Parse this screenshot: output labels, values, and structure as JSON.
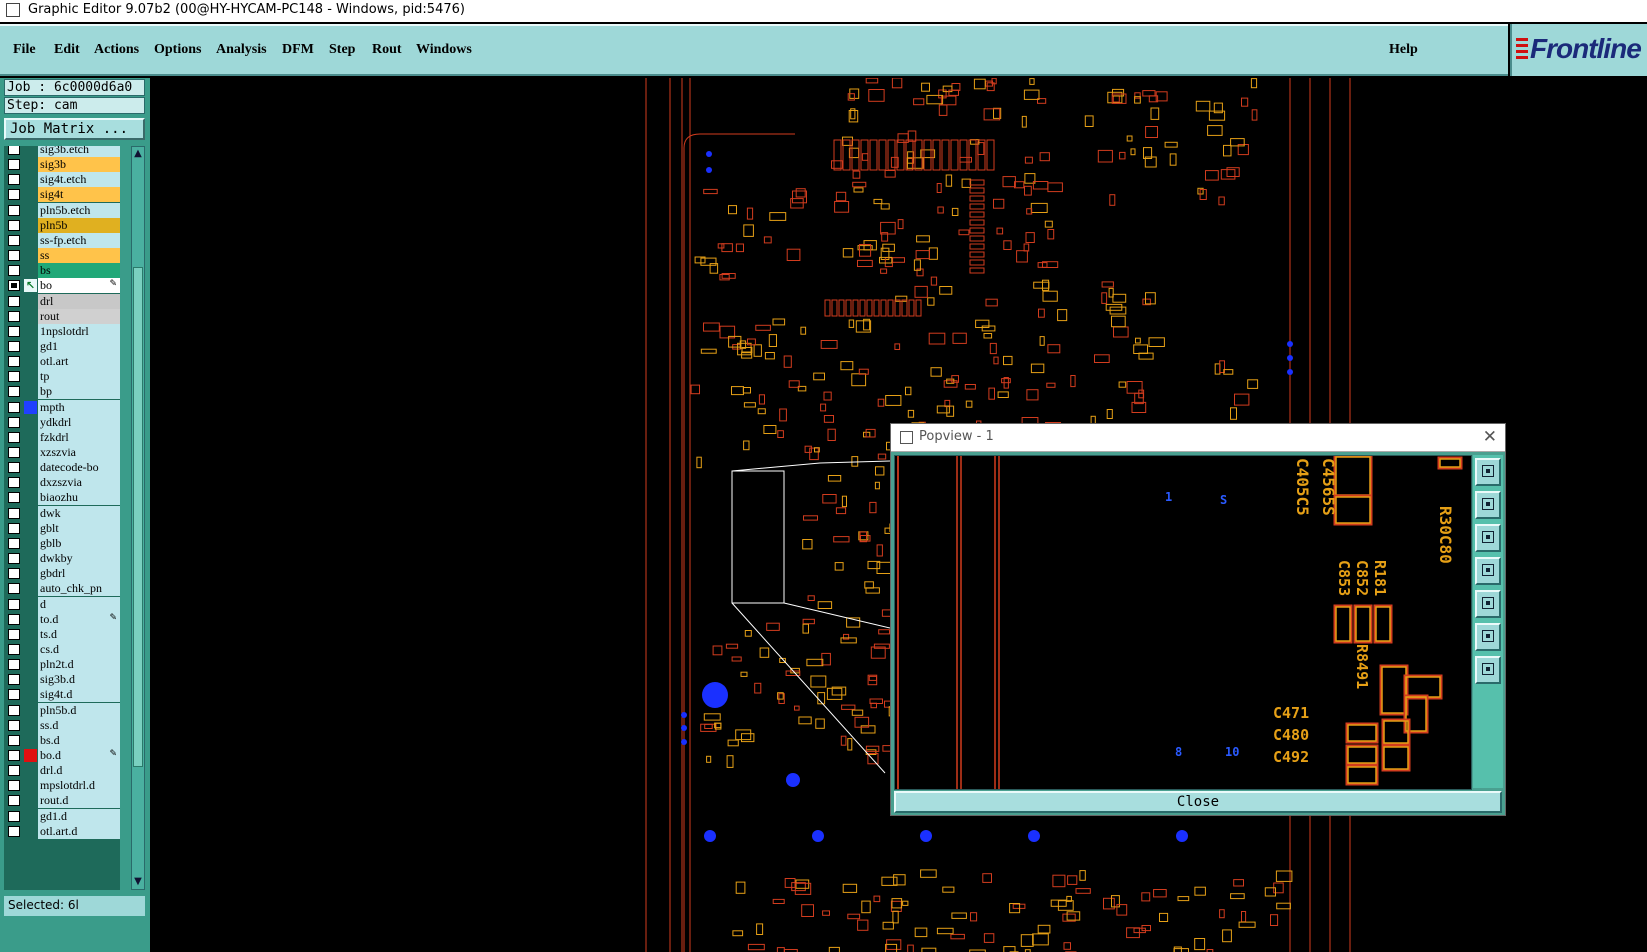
{
  "window": {
    "title": "Graphic Editor 9.07b2 (00@HY-HYCAM-PC148 - Windows, pid:5476)"
  },
  "menu": {
    "items": [
      "File",
      "Edit",
      "Actions",
      "Options",
      "Analysis",
      "DFM",
      "Step",
      "Rout",
      "Windows"
    ],
    "help": "Help"
  },
  "brand": {
    "logo": "Frontline"
  },
  "job": {
    "job_label": "Job : 6c0000d6a0",
    "step_label": "Step: cam",
    "matrix_button": "Job Matrix ..."
  },
  "layers": [
    {
      "name": "sig3b.etch",
      "color": "#bfe6ec"
    },
    {
      "name": "sig3b",
      "color": "#ffc34a"
    },
    {
      "name": "sig4t.etch",
      "color": "#bfe6ec"
    },
    {
      "name": "sig4t",
      "color": "#ffc34a"
    },
    {
      "name": "pln5b.etch",
      "color": "#bfe6ec"
    },
    {
      "name": "pln5b",
      "color": "#e0b020"
    },
    {
      "name": "ss-fp.etch",
      "color": "#bfe6ec"
    },
    {
      "name": "ss",
      "color": "#ffc34a"
    },
    {
      "name": "bs",
      "color": "#20a878"
    },
    {
      "name": "bo",
      "color": "#ffffff",
      "selected": true,
      "work": true,
      "icon": "edit"
    },
    {
      "name": "drl",
      "color": "#c8c8c8"
    },
    {
      "name": "rout",
      "color": "#d0d0d0"
    },
    {
      "name": "1npslotdrl",
      "color": "#bfe6ec"
    },
    {
      "name": "gd1",
      "color": "#bfe6ec"
    },
    {
      "name": "otl.art",
      "color": "#bfe6ec"
    },
    {
      "name": "tp",
      "color": "#bfe6ec"
    },
    {
      "name": "bp",
      "color": "#bfe6ec"
    },
    {
      "name": "mpth",
      "color": "#bfe6ec",
      "marker": "#2040ff"
    },
    {
      "name": "ydkdrl",
      "color": "#bfe6ec"
    },
    {
      "name": "fzkdrl",
      "color": "#bfe6ec"
    },
    {
      "name": "xzszvia",
      "color": "#bfe6ec"
    },
    {
      "name": "datecode-bo",
      "color": "#bfe6ec"
    },
    {
      "name": "dxzszvia",
      "color": "#bfe6ec"
    },
    {
      "name": "biaozhu",
      "color": "#bfe6ec"
    },
    {
      "name": "dwk",
      "color": "#bfe6ec"
    },
    {
      "name": "gblt",
      "color": "#bfe6ec"
    },
    {
      "name": "gblb",
      "color": "#bfe6ec"
    },
    {
      "name": "dwkby",
      "color": "#bfe6ec"
    },
    {
      "name": "gbdrl",
      "color": "#bfe6ec"
    },
    {
      "name": "auto_chk_pn",
      "color": "#bfe6ec"
    },
    {
      "name": "d",
      "color": "#bfe6ec"
    },
    {
      "name": "to.d",
      "color": "#bfe6ec",
      "icon": "edit"
    },
    {
      "name": "ts.d",
      "color": "#bfe6ec"
    },
    {
      "name": "cs.d",
      "color": "#bfe6ec"
    },
    {
      "name": "pln2t.d",
      "color": "#bfe6ec"
    },
    {
      "name": "sig3b.d",
      "color": "#bfe6ec"
    },
    {
      "name": "sig4t.d",
      "color": "#bfe6ec"
    },
    {
      "name": "pln5b.d",
      "color": "#bfe6ec"
    },
    {
      "name": "ss.d",
      "color": "#bfe6ec"
    },
    {
      "name": "bs.d",
      "color": "#bfe6ec"
    },
    {
      "name": "bo.d",
      "color": "#bfe6ec",
      "marker": "#e01010",
      "icon": "edit"
    },
    {
      "name": "drl.d",
      "color": "#bfe6ec"
    },
    {
      "name": "mpslotdrl.d",
      "color": "#bfe6ec"
    },
    {
      "name": "rout.d",
      "color": "#bfe6ec"
    },
    {
      "name": "gd1.d",
      "color": "#bfe6ec"
    },
    {
      "name": "otl.art.d",
      "color": "#bfe6ec"
    }
  ],
  "status": {
    "select_filter": "Selected: 6l"
  },
  "popview": {
    "title": "Popview - 1",
    "close_label": "Close",
    "labels": [
      "1",
      "S",
      "8",
      "10",
      "C405C5",
      "C4565S",
      "R30C80",
      "C853",
      "C852",
      "R181",
      "C471",
      "C480",
      "C492",
      "R8491"
    ]
  },
  "colors": {
    "trace": "#d23c1e",
    "pad": "#e6a016",
    "via": "#1a30ff",
    "outline": "#ffffff",
    "panel": "#3a9c8a"
  }
}
